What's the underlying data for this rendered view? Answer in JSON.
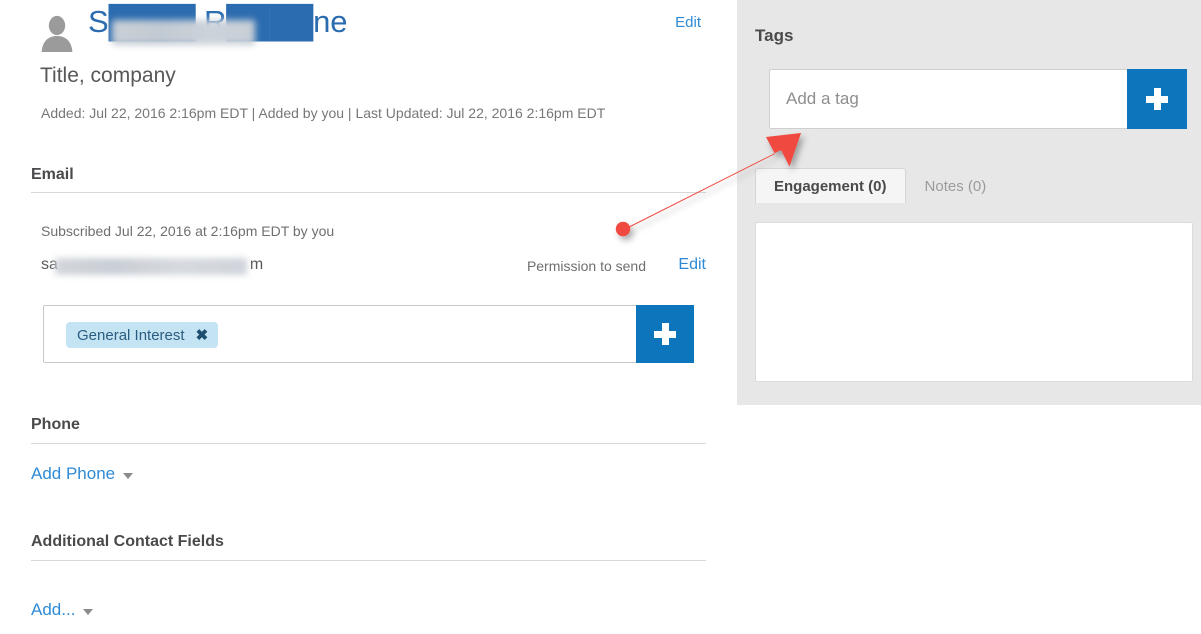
{
  "contact": {
    "name_text": "S████ R████ne",
    "name_visible_prefix": "S",
    "name_visible_suffix": "ne",
    "title_company": "Title, company",
    "meta": "Added: Jul 22, 2016 2:16pm EDT | Added by you | Last Updated: Jul 22, 2016 2:16pm EDT",
    "edit_label": "Edit",
    "avatar": "person-avatar-icon"
  },
  "email_section": {
    "heading": "Email",
    "subscribed": "Subscribed Jul 22, 2016 at 2:16pm EDT by you",
    "address_prefix": "sa",
    "address_suffix": "m",
    "permission": "Permission to send",
    "edit_label": "Edit",
    "interest_chip": "General Interest",
    "chip_remove": "✖",
    "add_button": "+"
  },
  "phone_section": {
    "heading": "Phone",
    "add_label": "Add Phone"
  },
  "additional_section": {
    "heading": "Additional Contact Fields",
    "add_label": "Add..."
  },
  "sidebar": {
    "tags_title": "Tags",
    "tag_placeholder": "Add a tag",
    "tag_value": "",
    "tag_add_button": "+",
    "tabs": [
      {
        "label": "Engagement (0)",
        "active": true
      },
      {
        "label": "Notes (0)",
        "active": false
      }
    ]
  },
  "annotation": {
    "arrow": "red-arrow-pointing-to-tag-input",
    "color": "#f0493f"
  },
  "colors": {
    "accent_blue": "#0c75bb",
    "link_blue": "#2e8ad6",
    "chip_blue": "#c5e4f3",
    "panel_gray": "#e7e7e7",
    "arrow_red": "#f0493f"
  }
}
